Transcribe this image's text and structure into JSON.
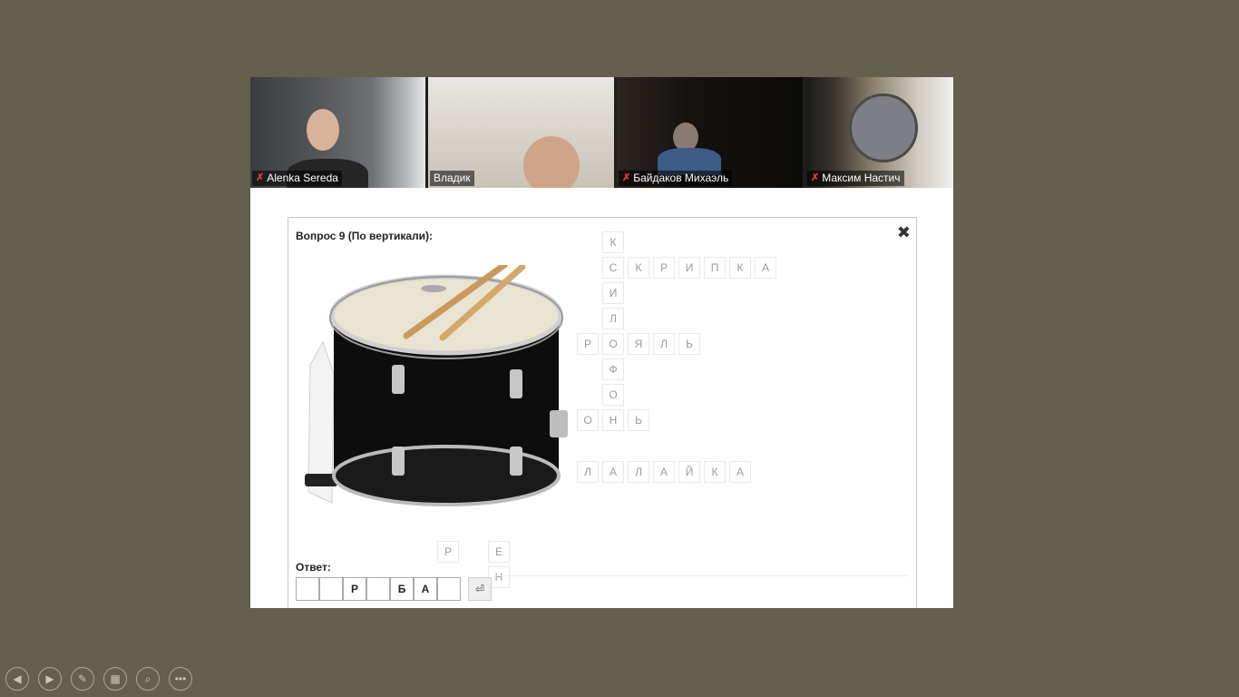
{
  "participants": [
    {
      "name": "Alenka Sereda",
      "muted": true
    },
    {
      "name": "Владик",
      "muted": false
    },
    {
      "name": "Байдаков Михаэль",
      "muted": true
    },
    {
      "name": "Максим Настич",
      "muted": true
    }
  ],
  "question": {
    "title": "Вопрос 9 (По вертикали):",
    "close_icon": "✖",
    "answer_label": "Ответ:",
    "answer_cells": [
      "",
      "",
      "Р",
      "",
      "Б",
      "А",
      ""
    ],
    "answer_button": "⏎"
  },
  "crossword_letters": {
    "col_k": [
      "К",
      "С",
      "И",
      "Л",
      "Р",
      "Ф",
      "О",
      "Н"
    ],
    "skripka": [
      "С",
      "К",
      "Р",
      "И",
      "П",
      "К",
      "А"
    ],
    "royal": [
      "Р",
      "О",
      "Я",
      "Л",
      "Ь"
    ],
    "on": [
      "О",
      "Н",
      "Ь"
    ],
    "balalaika": [
      "Л",
      "А",
      "Л",
      "А",
      "Й",
      "К",
      "А"
    ],
    "bottom": [
      "Р",
      "Е",
      "Н"
    ]
  },
  "controls": [
    "previous-slide",
    "next-slide",
    "pen",
    "slides-grid",
    "zoom",
    "more"
  ],
  "colors": {
    "background": "#655f4e",
    "mic_muted": "#e23b3b"
  }
}
